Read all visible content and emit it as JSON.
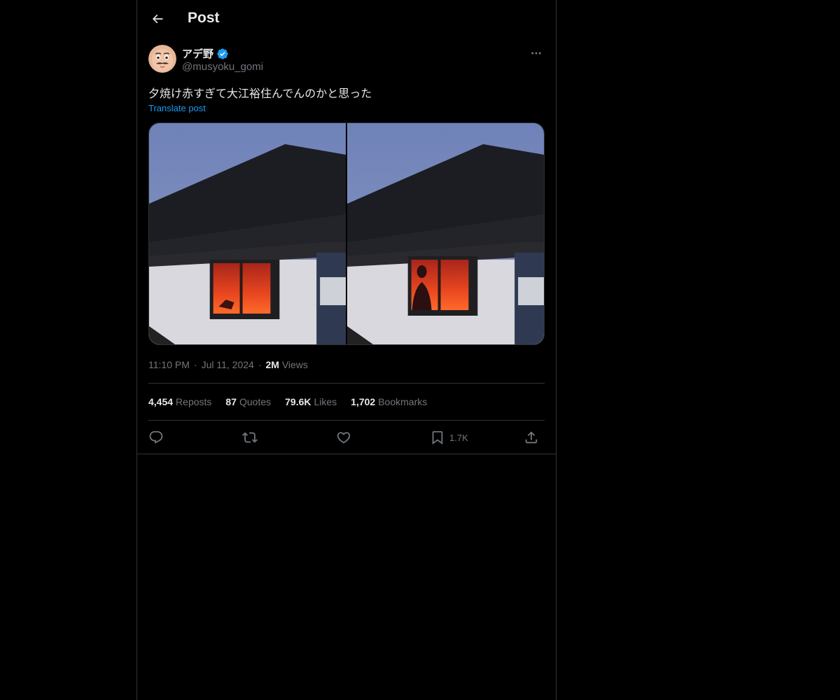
{
  "header": {
    "title": "Post"
  },
  "author": {
    "display_name": "アデ野",
    "handle": "@musyoku_gomi"
  },
  "post": {
    "text": "夕焼け赤すぎて大江裕住んでんのかと思った",
    "translate_label": "Translate post"
  },
  "meta": {
    "time": "11:10 PM",
    "separator": "·",
    "date": "Jul 11, 2024",
    "views_count": "2M",
    "views_label": "Views"
  },
  "stats": [
    {
      "count": "4,454",
      "label": "Reposts"
    },
    {
      "count": "87",
      "label": "Quotes"
    },
    {
      "count": "79.6K",
      "label": "Likes"
    },
    {
      "count": "1,702",
      "label": "Bookmarks"
    }
  ],
  "actions": {
    "bookmark_count": "1.7K"
  },
  "colors": {
    "background": "#000000",
    "border": "#2f3336",
    "text_primary": "#e7e9ea",
    "text_secondary": "#71767b",
    "accent": "#1d9bf0"
  },
  "icons": [
    "back-arrow-icon",
    "verified-badge-icon",
    "more-icon",
    "reply-icon",
    "repost-icon",
    "like-icon",
    "bookmark-icon",
    "share-icon"
  ]
}
